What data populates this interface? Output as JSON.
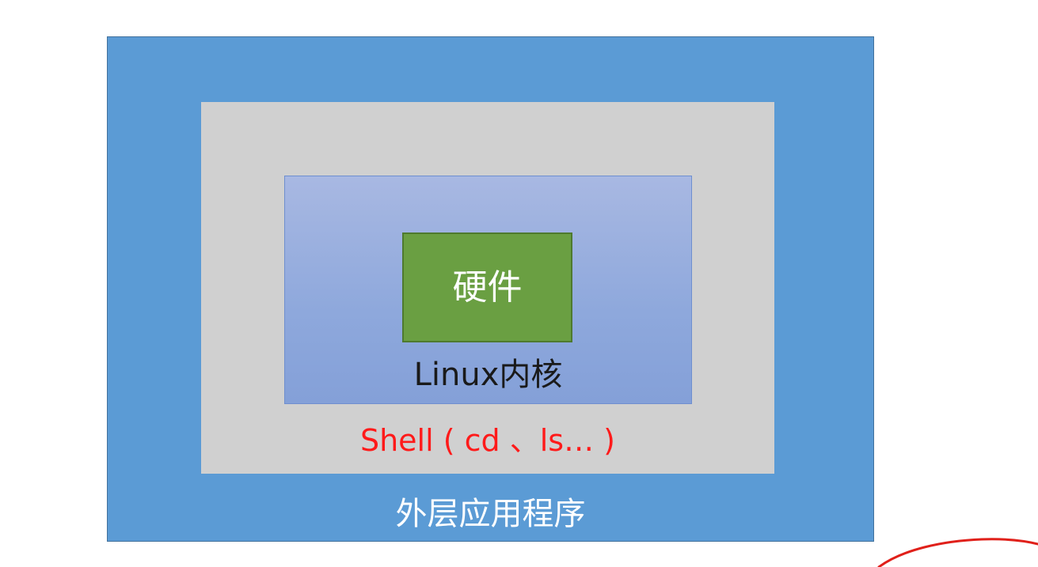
{
  "slide": {
    "top_cut_text_segments": [
      {
        "text": "",
        "color": "#ff2a2a"
      },
      {
        "text": "",
        "color": "#222222"
      }
    ]
  },
  "diagram": {
    "layers": {
      "outer": {
        "label": "外层应用程序",
        "fill": "#5b9bd5"
      },
      "shell": {
        "label": "Shell ( cd 、ls… )",
        "fill": "#d0d0d0",
        "label_color": "#ff1a1a"
      },
      "kernel": {
        "label": "Linux内核",
        "fill": "#8ea8dc"
      },
      "hardware": {
        "label": "硬件",
        "fill": "#6a9f42"
      }
    },
    "annotation": {
      "color": "#e0201a"
    }
  }
}
